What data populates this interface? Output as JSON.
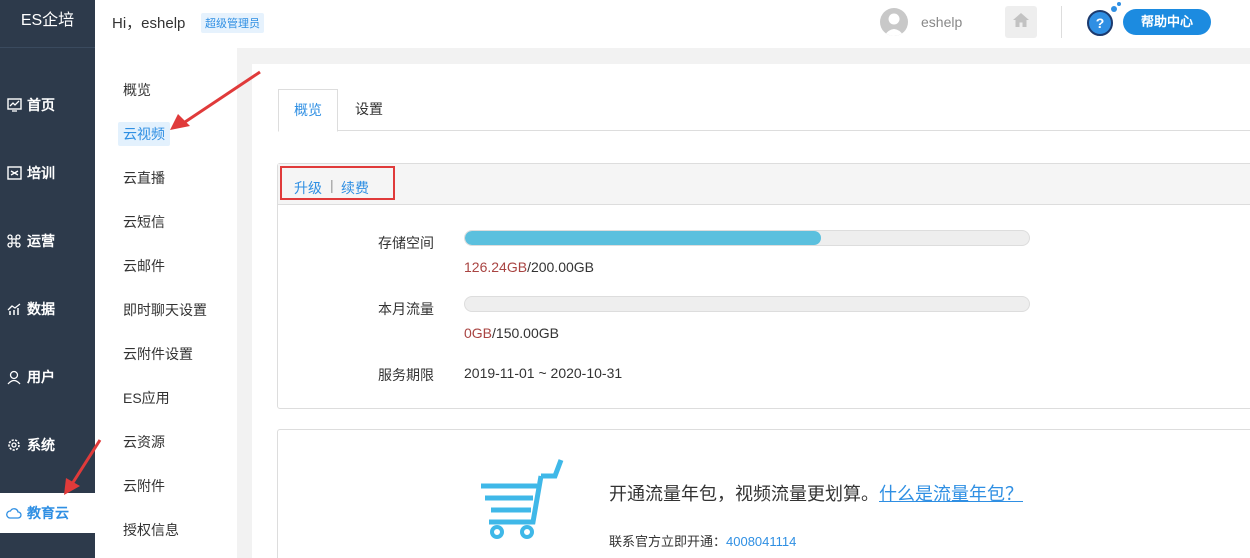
{
  "app": {
    "brand": "ES企培"
  },
  "header": {
    "greeting": "Hi，eshelp",
    "role_badge": "超级管理员",
    "username": "eshelp",
    "help_label": "帮助中心",
    "help_icon_text": "?"
  },
  "sidebar": {
    "items": [
      {
        "label": "首页",
        "icon": "chart-monitor-icon"
      },
      {
        "label": "培训",
        "icon": "book-icon"
      },
      {
        "label": "运营",
        "icon": "command-icon"
      },
      {
        "label": "数据",
        "icon": "bar-chart-icon"
      },
      {
        "label": "用户",
        "icon": "user-icon"
      },
      {
        "label": "系统",
        "icon": "gear-icon"
      },
      {
        "label": "教育云",
        "icon": "cloud-icon",
        "active": true
      }
    ]
  },
  "subnav": {
    "items": [
      {
        "label": "概览"
      },
      {
        "label": "云视频",
        "active": true
      },
      {
        "label": "云直播"
      },
      {
        "label": "云短信"
      },
      {
        "label": "云邮件"
      },
      {
        "label": "即时聊天设置"
      },
      {
        "label": "云附件设置"
      },
      {
        "label": "ES应用"
      },
      {
        "label": "云资源"
      },
      {
        "label": "云附件"
      },
      {
        "label": "授权信息"
      }
    ]
  },
  "tabs": [
    {
      "label": "概览",
      "active": true
    },
    {
      "label": "设置"
    }
  ],
  "actions": {
    "upgrade": "升级",
    "separator": "|",
    "renew": "续费"
  },
  "storage": {
    "label": "存储空间",
    "used": "126.24GB",
    "total": "/200.00GB",
    "fraction": 0.6312
  },
  "traffic": {
    "label": "本月流量",
    "used": "0GB",
    "total": "/150.00GB",
    "fraction": 0
  },
  "service": {
    "label": "服务期限",
    "period": "2019-11-01 ~ 2020-10-31"
  },
  "promo": {
    "text": "开通流量年包，视频流量更划算。",
    "link": "什么是流量年包？",
    "contact_label": "联系官方立即开通：",
    "phone": "4008041114"
  },
  "colors": {
    "accent": "#2f8fe3",
    "sidebar": "#2d3a4b",
    "bar_fill": "#5bc0de",
    "used_text": "#a94442",
    "highlight": "#e03a3a"
  }
}
